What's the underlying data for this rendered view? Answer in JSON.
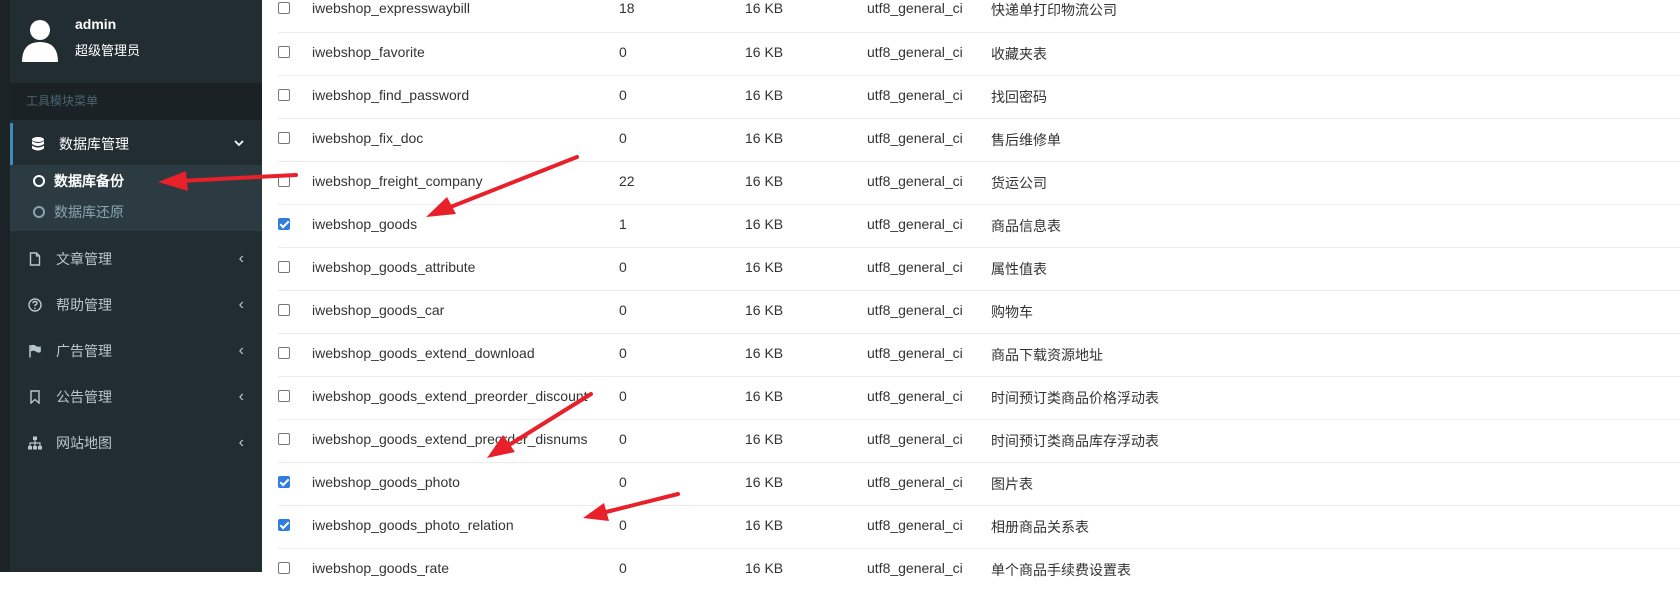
{
  "user": {
    "name": "admin",
    "role": "超级管理员"
  },
  "sidebar": {
    "header": "工具模块菜单",
    "menus": [
      {
        "label": "数据库管理",
        "icon": "database-icon",
        "chevron": "⌄",
        "expanded": true
      },
      {
        "label": "文章管理",
        "icon": "file-icon",
        "chevron": "‹"
      },
      {
        "label": "帮助管理",
        "icon": "question-circle-icon",
        "chevron": "‹"
      },
      {
        "label": "广告管理",
        "icon": "flag-icon",
        "chevron": "‹"
      },
      {
        "label": "公告管理",
        "icon": "bookmark-icon",
        "chevron": "‹"
      },
      {
        "label": "网站地图",
        "icon": "sitemap-icon",
        "chevron": "‹"
      }
    ],
    "submenu": [
      {
        "label": "数据库备份",
        "active": true
      },
      {
        "label": "数据库还原",
        "active": false
      }
    ]
  },
  "table": {
    "rows": [
      {
        "name": "iwebshop_expresswaybill",
        "rows": "18",
        "size": "16 KB",
        "collation": "utf8_general_ci",
        "comment": "快递单打印物流公司",
        "checked": false
      },
      {
        "name": "iwebshop_favorite",
        "rows": "0",
        "size": "16 KB",
        "collation": "utf8_general_ci",
        "comment": "收藏夹表",
        "checked": false
      },
      {
        "name": "iwebshop_find_password",
        "rows": "0",
        "size": "16 KB",
        "collation": "utf8_general_ci",
        "comment": "找回密码",
        "checked": false
      },
      {
        "name": "iwebshop_fix_doc",
        "rows": "0",
        "size": "16 KB",
        "collation": "utf8_general_ci",
        "comment": "售后维修单",
        "checked": false
      },
      {
        "name": "iwebshop_freight_company",
        "rows": "22",
        "size": "16 KB",
        "collation": "utf8_general_ci",
        "comment": "货运公司",
        "checked": false
      },
      {
        "name": "iwebshop_goods",
        "rows": "1",
        "size": "16 KB",
        "collation": "utf8_general_ci",
        "comment": "商品信息表",
        "checked": true
      },
      {
        "name": "iwebshop_goods_attribute",
        "rows": "0",
        "size": "16 KB",
        "collation": "utf8_general_ci",
        "comment": "属性值表",
        "checked": false
      },
      {
        "name": "iwebshop_goods_car",
        "rows": "0",
        "size": "16 KB",
        "collation": "utf8_general_ci",
        "comment": "购物车",
        "checked": false
      },
      {
        "name": "iwebshop_goods_extend_download",
        "rows": "0",
        "size": "16 KB",
        "collation": "utf8_general_ci",
        "comment": "商品下载资源地址",
        "checked": false
      },
      {
        "name": "iwebshop_goods_extend_preorder_discount",
        "rows": "0",
        "size": "16 KB",
        "collation": "utf8_general_ci",
        "comment": "时间预订类商品价格浮动表",
        "checked": false
      },
      {
        "name": "iwebshop_goods_extend_preorder_disnums",
        "rows": "0",
        "size": "16 KB",
        "collation": "utf8_general_ci",
        "comment": "时间预订类商品库存浮动表",
        "checked": false
      },
      {
        "name": "iwebshop_goods_photo",
        "rows": "0",
        "size": "16 KB",
        "collation": "utf8_general_ci",
        "comment": "图片表",
        "checked": true
      },
      {
        "name": "iwebshop_goods_photo_relation",
        "rows": "0",
        "size": "16 KB",
        "collation": "utf8_general_ci",
        "comment": "相册商品关系表",
        "checked": true
      },
      {
        "name": "iwebshop_goods_rate",
        "rows": "0",
        "size": "16 KB",
        "collation": "utf8_general_ci",
        "comment": "单个商品手续费设置表",
        "checked": false
      }
    ]
  },
  "colors": {
    "sidebar_bg": "#222d32",
    "submenu_bg": "#2c3b41",
    "arrow": "#e8202a",
    "checkbox_checked": "#2f7de1"
  }
}
